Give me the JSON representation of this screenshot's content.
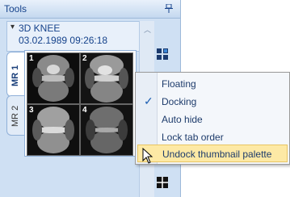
{
  "panel": {
    "title": "Tools",
    "pin_glyph": "ᴘ"
  },
  "series": {
    "name": "3D KNEE",
    "datetime": "03.02.1989 09:26:18"
  },
  "tabs": [
    {
      "label": "MR 1",
      "active": true
    },
    {
      "label": "MR 2",
      "active": false
    }
  ],
  "thumbnails": [
    {
      "number": "1"
    },
    {
      "number": "2"
    },
    {
      "number": "3"
    },
    {
      "number": "4"
    }
  ],
  "context_menu": {
    "items": [
      {
        "label": "Floating",
        "checked": false,
        "highlighted": false
      },
      {
        "label": "Docking",
        "checked": true,
        "highlighted": false
      },
      {
        "label": "Auto hide",
        "checked": false,
        "highlighted": false
      },
      {
        "label": "Lock tab order",
        "checked": false,
        "highlighted": false
      },
      {
        "label": "Undock thumbnail palette",
        "checked": false,
        "highlighted": true
      }
    ]
  },
  "icons": {
    "pin": "pin-icon",
    "collapse": "chevron-down-icon",
    "scroll_up": "scroll-up-arrow-icon",
    "layout_top": "layout-grid-icon",
    "layout_bottom": "layout-split-icon",
    "cursor": "mouse-pointer-icon"
  },
  "colors": {
    "panel_bg": "#cfe0f3",
    "title_text": "#15428b",
    "menu_highlight": "#fde9a5",
    "check": "#1d5fb3"
  }
}
